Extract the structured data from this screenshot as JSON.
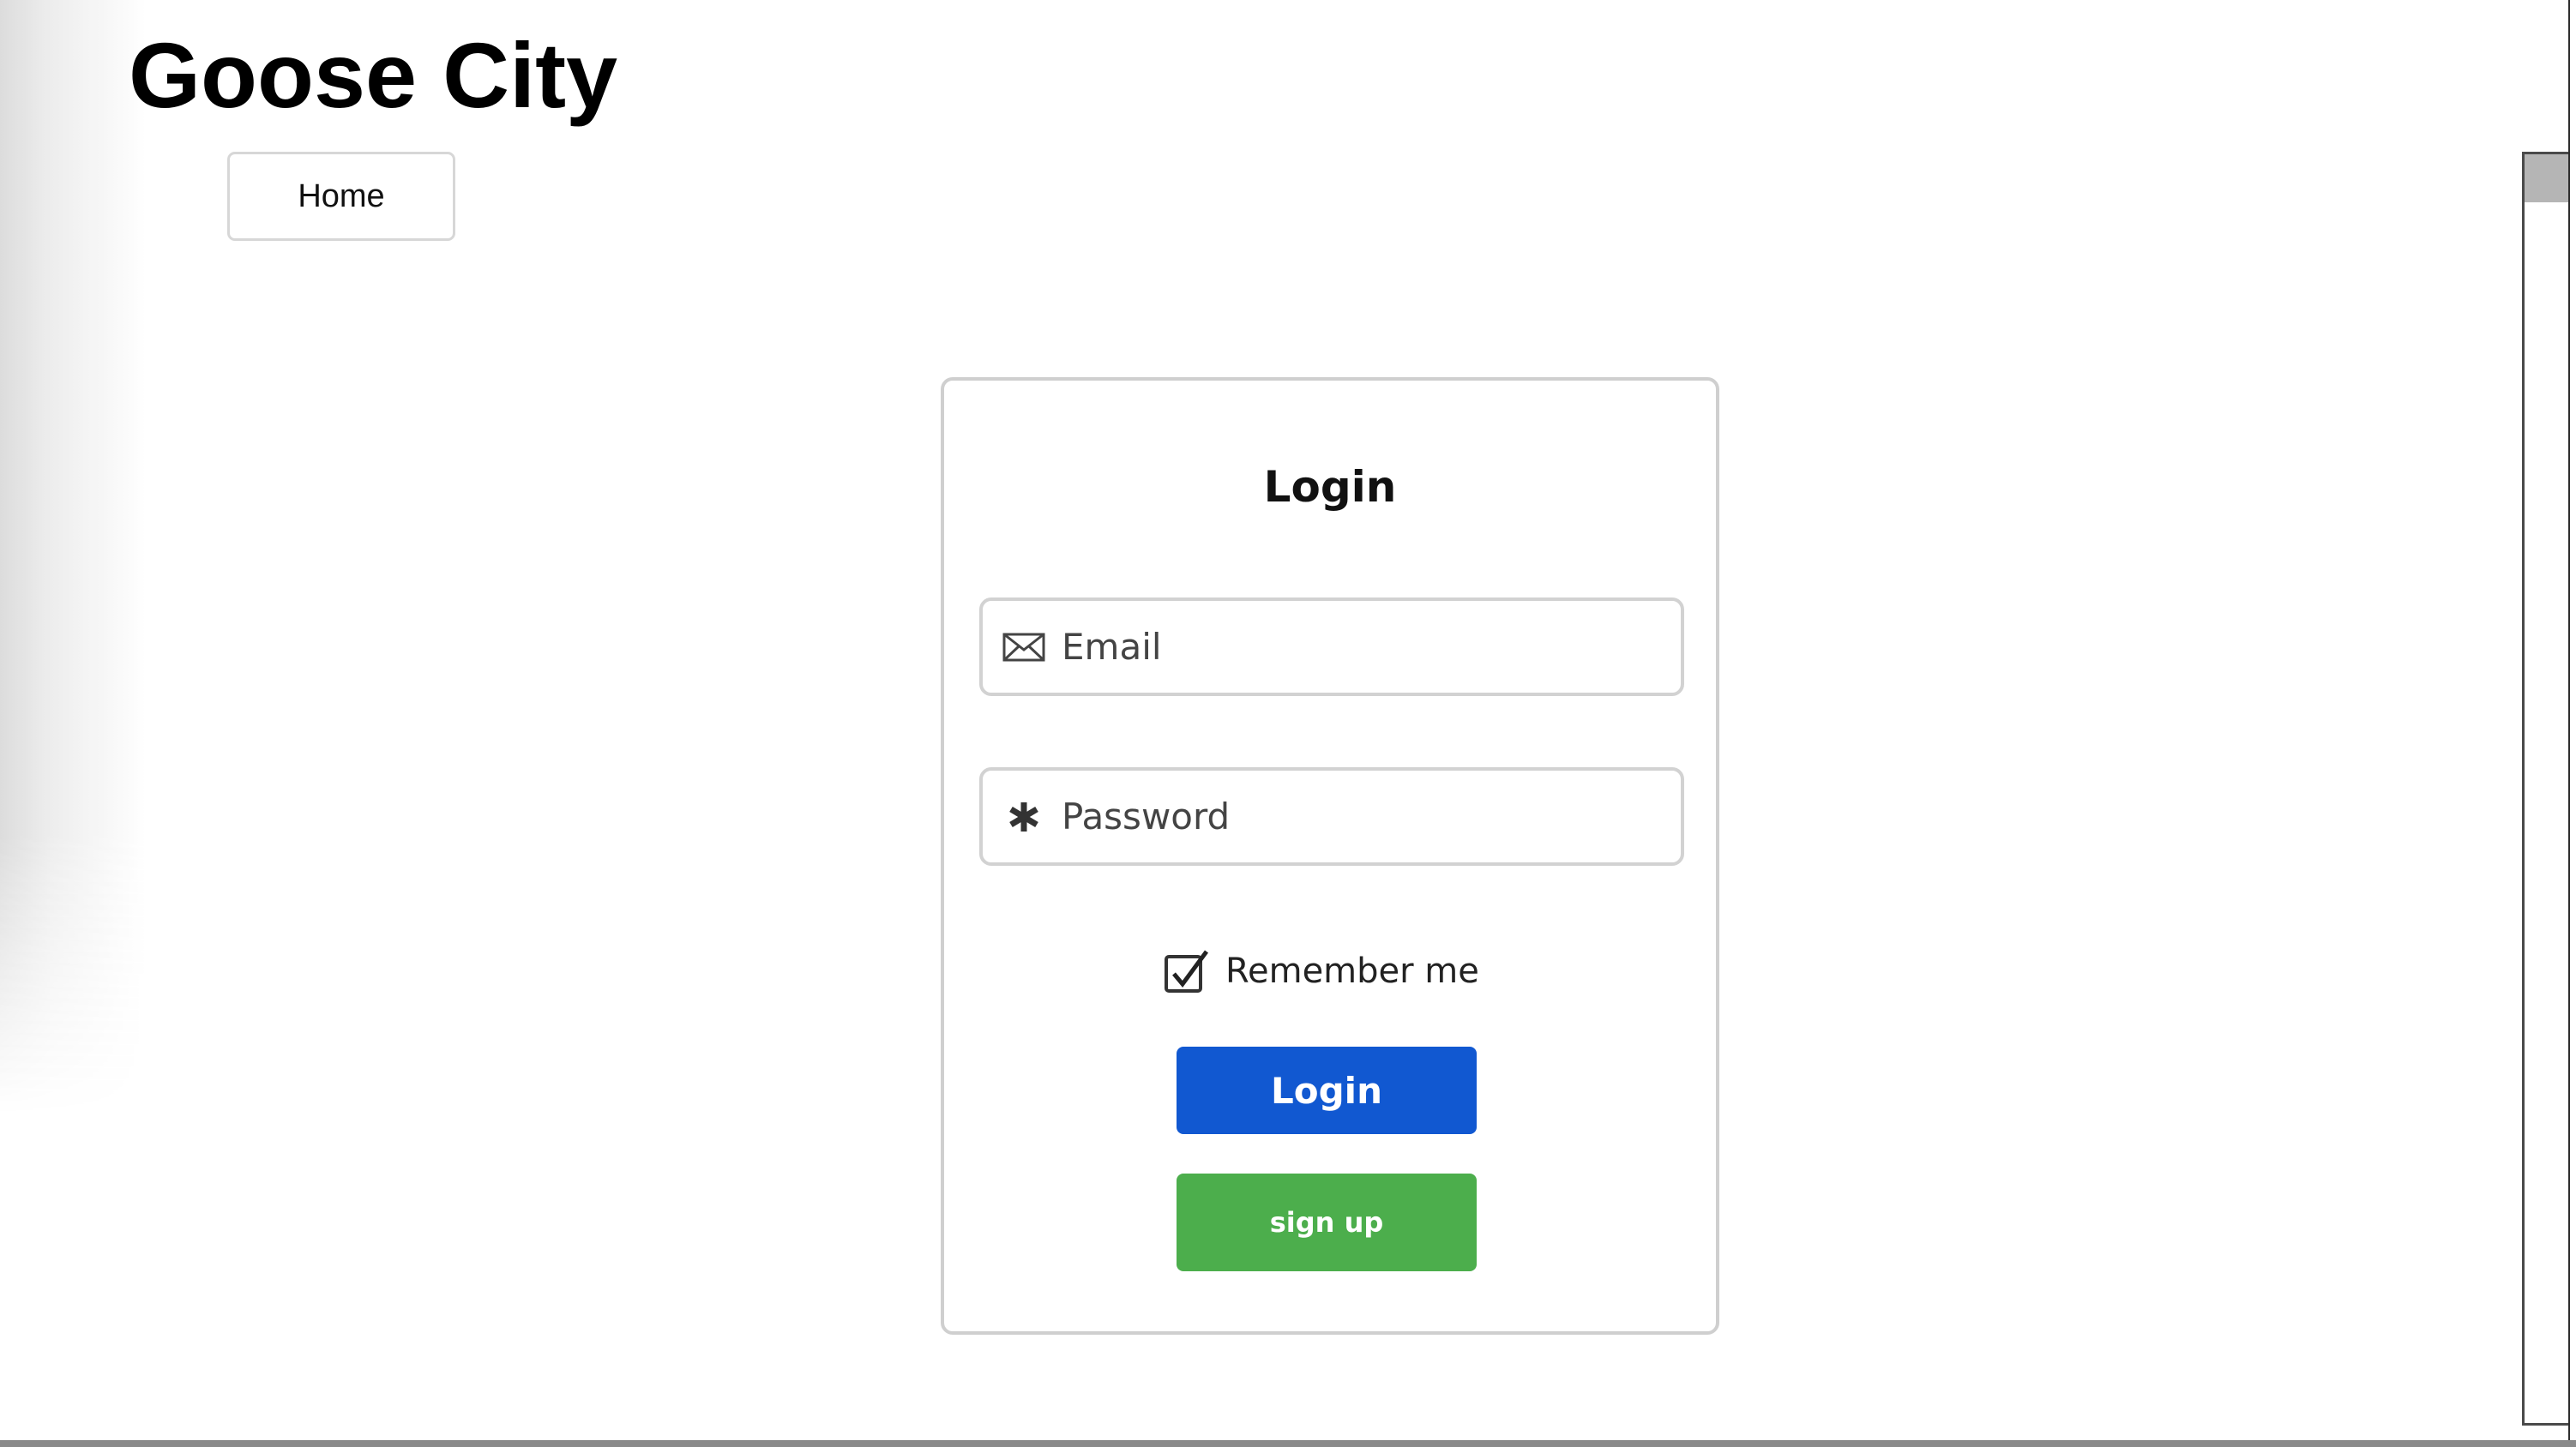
{
  "header": {
    "site_title": "Goose City",
    "nav": {
      "home_label": "Home"
    }
  },
  "login_form": {
    "heading": "Login",
    "email": {
      "placeholder": "Email",
      "value": "",
      "icon": "envelope-icon"
    },
    "password": {
      "placeholder": "Password",
      "value": "",
      "icon": "asterisk-icon"
    },
    "remember": {
      "label": "Remember me",
      "checked": true
    },
    "login_button_label": "Login",
    "signup_button_label": "sign up"
  },
  "colors": {
    "login_button": "#1158d1",
    "signup_button": "#4cae4c",
    "border": "#d2d2d2"
  }
}
